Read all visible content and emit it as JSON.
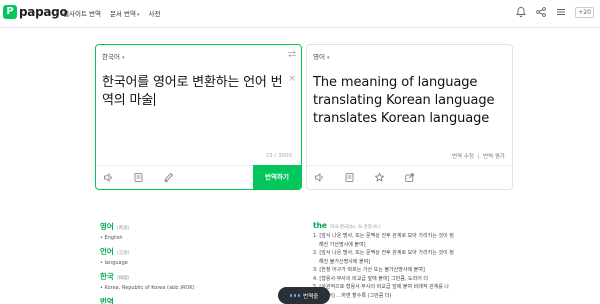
{
  "header": {
    "logo_mark": "P",
    "logo_text": "papago",
    "nav": [
      {
        "label": "웹사이트 번역"
      },
      {
        "label": "문서 번역"
      },
      {
        "label": "사전"
      }
    ],
    "badge": "+20",
    "icons": [
      "bell-icon",
      "share-icon",
      "menu-icon"
    ]
  },
  "source": {
    "language": "한국어",
    "text": "한국어를 영어로 변환하는 언어 번역의 마술",
    "counter": "23 / 3000",
    "translate_label": "번역하기",
    "icons": [
      "speaker-icon",
      "note-icon",
      "handwrite-icon"
    ]
  },
  "target": {
    "language": "영어",
    "text": "The meaning of language translating Korean language translates Korean language",
    "action_edit": "번역 수정",
    "action_rate": "번역 평가",
    "icons": [
      "speaker-icon",
      "copy-icon",
      "star-icon",
      "share-icon"
    ]
  },
  "dictionary": {
    "left": [
      {
        "word": "영어",
        "tag": "(英語)",
        "meaning": "• English"
      },
      {
        "word": "언어",
        "tag": "(言語)",
        "meaning": "• language"
      },
      {
        "word": "한국",
        "tag": "(韓國)",
        "meaning": "• Korea, Republic of Korea (abb.)ROK)"
      },
      {
        "word": "번역",
        "tag": "",
        "meaning": ""
      }
    ],
    "right": {
      "word": "the",
      "tag": "미국·영국[ðə, ði 강형 ðiː]",
      "lines": [
        {
          "text": "1. [앞서 나온 명사, 또는 문맥상 전후 관계로 보아 가리키는 것이 정",
          "indent": false
        },
        {
          "text": "해진 가산명사에 붙여]",
          "indent": true
        },
        {
          "text": "2. [앞서 나온 명사, 또는 문맥상 전후 관계로 보아 가리키는 것이 정",
          "indent": false
        },
        {
          "text": "해진 불가산명사에 붙여]",
          "indent": true
        },
        {
          "text": "3. [한정 어구가 따르는 가산 또는 불가산명사에 붙여]",
          "indent": false
        },
        {
          "text": "4. [형용사·부사의 비교급 앞에 붙여] 그만큼, 도리어 더",
          "indent": false
        },
        {
          "text": "5. [상관적으로 형용사·부사의 비교급 앞에 붙여 비례적 관계를 나",
          "indent": false
        },
        {
          "text": "타내어] …하면 할수록 (그만큼 더)",
          "indent": true
        }
      ]
    }
  },
  "pill": {
    "label": "번역중"
  },
  "colors": {
    "brand": "#03c75a",
    "pill_bg": "#2b3035",
    "pill_dot": "#5fb0ff"
  }
}
